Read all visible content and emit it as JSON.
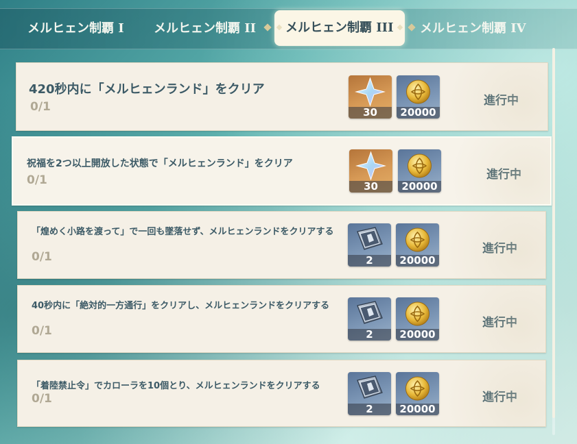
{
  "tabs": [
    {
      "label": "メルヒェン制覇 I"
    },
    {
      "label": "メルヒェン制覇 II"
    },
    {
      "label": "メルヒェン制覇 III",
      "active": true
    },
    {
      "label": "メルヒェン制覇 IV"
    }
  ],
  "quests": [
    {
      "title": "420秒内に「メルヒェンランド」をクリア",
      "progress": "0/1",
      "status": "進行中",
      "rewards": [
        {
          "icon": "primogem-icon",
          "count": "30"
        },
        {
          "icon": "mora-coin-icon",
          "count": "20000"
        }
      ]
    },
    {
      "title": "祝福を2つ以上開放した状態で「メルヒェンランド」をクリア",
      "progress": "0/1",
      "status": "進行中",
      "rewards": [
        {
          "icon": "primogem-icon",
          "count": "30"
        },
        {
          "icon": "mora-coin-icon",
          "count": "20000"
        }
      ]
    },
    {
      "title": "「煌めく小路を渡って」で一回も墜落せず、メルヒェンランドをクリアする",
      "progress": "0/1",
      "status": "進行中",
      "rewards": [
        {
          "icon": "talent-book-icon",
          "count": "2"
        },
        {
          "icon": "mora-coin-icon",
          "count": "20000"
        }
      ]
    },
    {
      "title": "40秒内に「絶対的一方通行」をクリアし、メルヒェンランドをクリアする",
      "progress": "0/1",
      "status": "進行中",
      "rewards": [
        {
          "icon": "talent-book-icon",
          "count": "2"
        },
        {
          "icon": "mora-coin-icon",
          "count": "20000"
        }
      ]
    },
    {
      "title": "「着陸禁止令」でカローラを10個とり、メルヒェンランドをクリアする",
      "progress": "0/1",
      "status": "進行中",
      "rewards": [
        {
          "icon": "talent-book-icon",
          "count": "2"
        },
        {
          "icon": "mora-coin-icon",
          "count": "20000"
        }
      ]
    }
  ],
  "colors": {
    "card_bg": "#f5f0e6",
    "text_primary": "#3c5a66",
    "text_muted": "#b0a894",
    "active_tab_bg": "#fbf6e6"
  }
}
